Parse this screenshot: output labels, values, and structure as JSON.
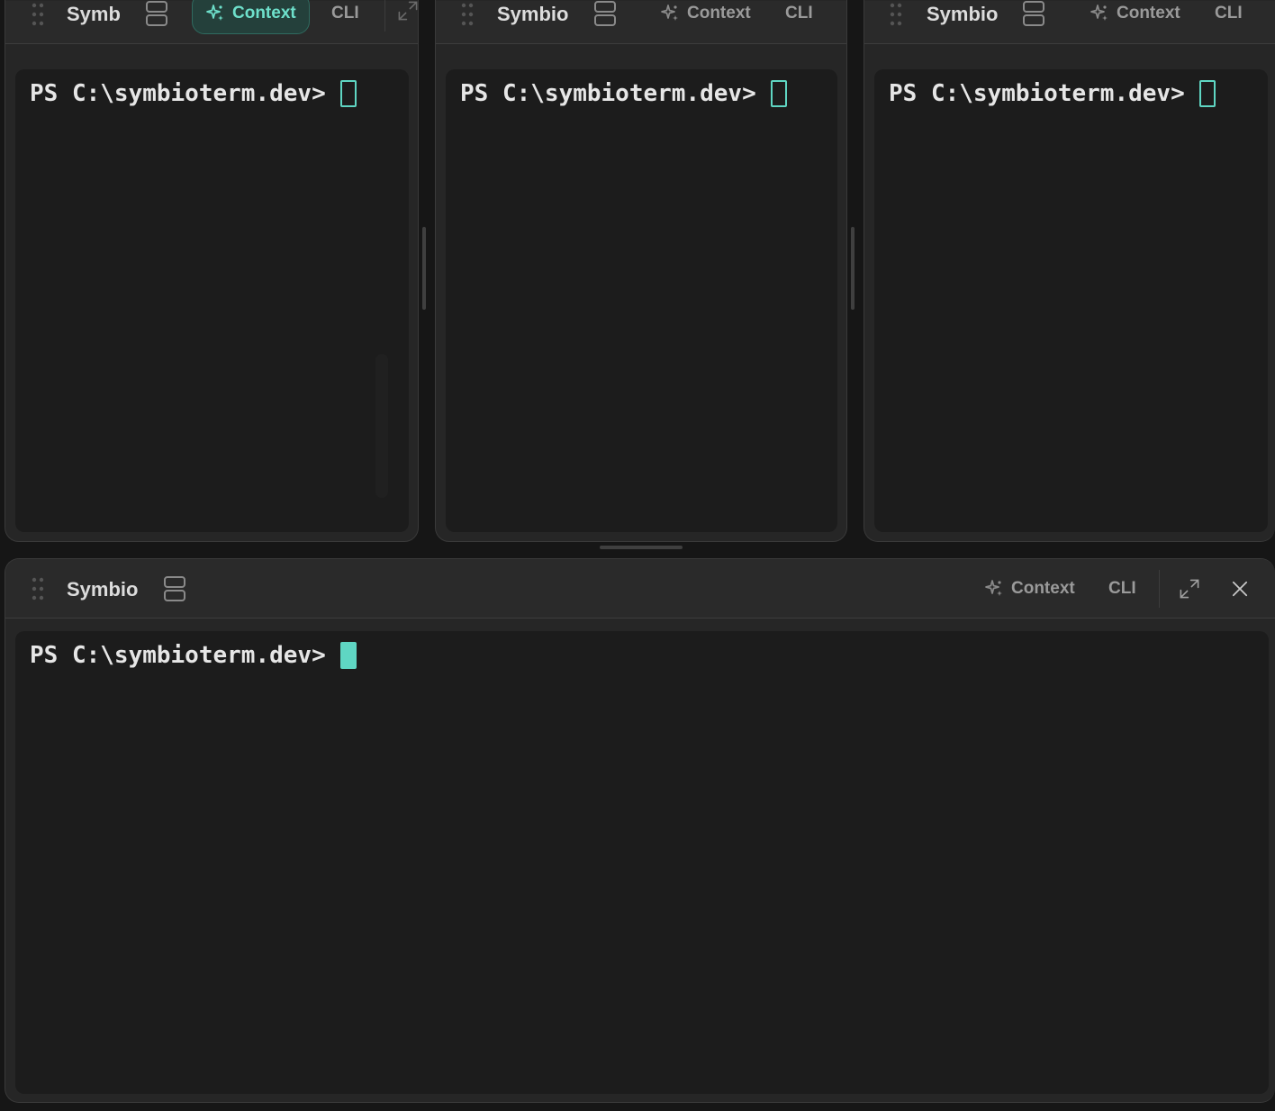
{
  "theme": {
    "accent": "#5fd6c3",
    "accent_active_bg": "#24403b",
    "pane_bg": "#262626",
    "terminal_bg": "#1c1c1c",
    "text_muted": "#9a9a9a"
  },
  "panes": [
    {
      "title": "Symb",
      "context_label": "Context",
      "context_active": true,
      "cli_label": "CLI",
      "prompt": "PS C:\\symbioterm.dev>",
      "cursor_focused": false,
      "icons": [
        "drag-handle-icon",
        "split-view-icon",
        "sparkle-icon",
        "expand-icon"
      ]
    },
    {
      "title": "Symbio",
      "context_label": "Context",
      "context_active": false,
      "cli_label": "CLI",
      "prompt": "PS C:\\symbioterm.dev>",
      "cursor_focused": false,
      "icons": [
        "drag-handle-icon",
        "split-view-icon",
        "sparkle-icon"
      ]
    },
    {
      "title": "Symbio",
      "context_label": "Context",
      "context_active": false,
      "cli_label": "CLI",
      "prompt": "PS C:\\symbioterm.dev>",
      "cursor_focused": false,
      "icons": [
        "drag-handle-icon",
        "split-view-icon",
        "sparkle-icon"
      ]
    },
    {
      "title": "Symbio",
      "context_label": "Context",
      "context_active": false,
      "cli_label": "CLI",
      "prompt": "PS C:\\symbioterm.dev>",
      "cursor_focused": true,
      "icons": [
        "drag-handle-icon",
        "split-view-icon",
        "sparkle-icon",
        "expand-icon",
        "close-icon"
      ]
    }
  ]
}
